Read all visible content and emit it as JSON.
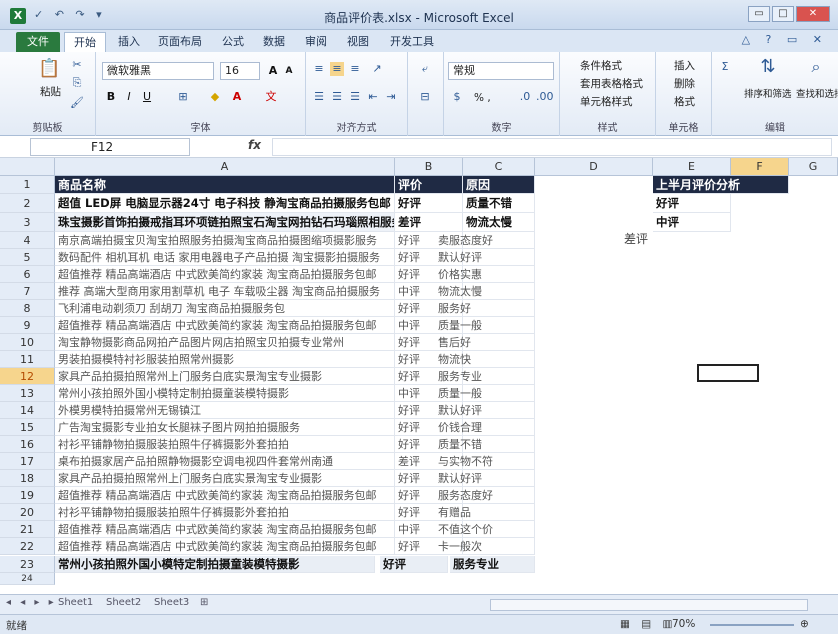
{
  "window": {
    "title": "商品评价表.xlsx - Microsoft Excel",
    "buttons": [
      "▭",
      "□",
      "✕"
    ]
  },
  "qat_icons": "✓ ↶ ↷ ▾",
  "tabs": [
    {
      "label": "文件"
    },
    {
      "label": "开始"
    },
    {
      "label": "插入"
    },
    {
      "label": "页面布局"
    },
    {
      "label": "公式"
    },
    {
      "label": "数据"
    },
    {
      "label": "审阅"
    },
    {
      "label": "视图"
    },
    {
      "label": "开发工具"
    }
  ],
  "ribbon": {
    "clipboard": {
      "paste": "粘贴",
      "label": "剪贴板"
    },
    "font": {
      "name": "微软雅黑",
      "size": "16",
      "label": "字体"
    },
    "alignment": {
      "label": "对齐方式"
    },
    "number": {
      "format": "常规",
      "pct": "% ,",
      "label": "数字"
    },
    "styles": {
      "cond": "条件格式",
      "table": "套用表格格式",
      "cell": "单元格样式",
      "label": "样式"
    },
    "cells": {
      "insert": "插入",
      "delete": "删除",
      "format": "格式",
      "label": "单元格"
    },
    "editing": {
      "sort": "排序和筛选",
      "find": "查找和选择",
      "label": "编辑"
    }
  },
  "formula_bar": {
    "name_box": "F12",
    "fx": "fx",
    "value": ""
  },
  "columns": [
    "A",
    "B",
    "C",
    "D",
    "E",
    "F",
    "G"
  ],
  "header_row": {
    "a": "商品名称",
    "b": "评价",
    "c": "原因",
    "e": "上半月评价分析"
  },
  "bold_rows": [
    {
      "row": "2",
      "a": "超值 LED屏 电脑显示器24寸 电子科技 静淘宝商品拍摄服务包邮",
      "b": "好评",
      "c": "质量不错",
      "e": "好评"
    },
    {
      "row": "3",
      "a": "珠宝摄影首饰拍摄戒指耳环项链拍照宝石淘宝网拍钻石玛瑙照相服务",
      "b": "差评",
      "c": "物流太慢",
      "e": "中评"
    }
  ],
  "float_label": "差评",
  "rows": [
    {
      "row": "4",
      "a": "南京高端拍摄宝贝淘宝拍照服务拍摄淘宝商品拍摄图缩项摄影服务",
      "b": "好评",
      "c": "卖服态度好"
    },
    {
      "row": "5",
      "a": "数码配件 相机耳机 电话 家用电器电子产品拍摄 淘宝摄影拍摄服务",
      "b": "好评",
      "c": "默认好评"
    },
    {
      "row": "6",
      "a": "超值推荐 精品高端酒店 中式欧美简约家装 淘宝商品拍摄服务包邮",
      "b": "好评",
      "c": "价格实惠"
    },
    {
      "row": "7",
      "a": "推荐 高端大型商用家用割草机 电子 车载吸尘器 淘宝商品拍摄服务",
      "b": "中评",
      "c": "物流太慢"
    },
    {
      "row": "8",
      "a": "飞利浦电动剃须刀 刮胡刀 淘宝商品拍摄服务包",
      "b": "好评",
      "c": "服务好"
    },
    {
      "row": "9",
      "a": "超值推荐 精品高端酒店 中式欧美简约家装 淘宝商品拍摄服务包邮",
      "b": "中评",
      "c": "质量一般"
    },
    {
      "row": "10",
      "a": "淘宝静物摄影商品网拍产品图片网店拍照宝贝拍摄专业常州",
      "b": "好评",
      "c": "售后好"
    },
    {
      "row": "11",
      "a": "男装拍摄模特衬衫服装拍照常州摄影",
      "b": "好评",
      "c": "物流快"
    },
    {
      "row": "12",
      "a": "家具产品拍摄拍照常州上门服务白底实景淘宝专业摄影",
      "b": "好评",
      "c": "服务专业"
    },
    {
      "row": "13",
      "a": "常州小孩拍照外国小模特定制拍摄童装模特摄影",
      "b": "中评",
      "c": "质量一般"
    },
    {
      "row": "14",
      "a": "外模男模特拍摄常州无锡镇江",
      "b": "好评",
      "c": "默认好评"
    },
    {
      "row": "15",
      "a": "广告淘宝摄影专业拍女长腿袜子图片网拍拍摄服务",
      "b": "好评",
      "c": "价钱合理"
    },
    {
      "row": "16",
      "a": "衬衫平铺静物拍摄服装拍照牛仔裤摄影外套拍拍",
      "b": "好评",
      "c": "质量不错"
    },
    {
      "row": "17",
      "a": "桌布拍摄家居产品拍照静物摄影空调电视四件套常州南通",
      "b": "差评",
      "c": "与实物不符"
    },
    {
      "row": "18",
      "a": "家具产品拍摄拍照常州上门服务白底实景淘宝专业摄影",
      "b": "好评",
      "c": "默认好评"
    },
    {
      "row": "19",
      "a": "超值推荐 精品高端酒店 中式欧美简约家装 淘宝商品拍摄服务包邮",
      "b": "好评",
      "c": "服务态度好"
    },
    {
      "row": "20",
      "a": "衬衫平铺静物拍摄服装拍照牛仔裤摄影外套拍拍",
      "b": "好评",
      "c": "有赠品"
    },
    {
      "row": "21",
      "a": "超值推荐 精品高端酒店 中式欧美简约家装 淘宝商品拍摄服务包邮",
      "b": "中评",
      "c": "不值这个价"
    },
    {
      "row": "22",
      "a": "超值推荐 精品高端酒店 中式欧美简约家装 淘宝商品拍摄服务包邮",
      "b": "好评",
      "c": "卡一般次"
    }
  ],
  "row23": {
    "row": "23",
    "a": "常州小孩拍照外国小模特定制拍摄童装模特摄影",
    "b": "好评",
    "c": "服务专业"
  },
  "row24": {
    "row": "24"
  },
  "sheets": [
    "Sheet1",
    "Sheet2",
    "Sheet3"
  ],
  "status": {
    "ready": "就绪",
    "zoom": "70%"
  }
}
